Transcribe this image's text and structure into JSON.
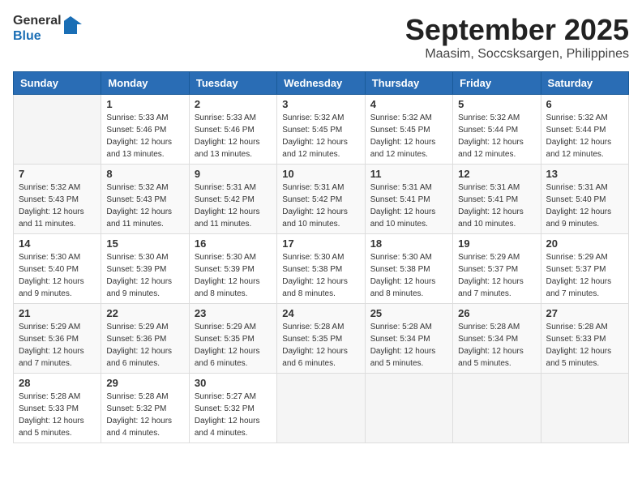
{
  "header": {
    "logo_line1": "General",
    "logo_line2": "Blue",
    "month_title": "September 2025",
    "location": "Maasim, Soccsksargen, Philippines"
  },
  "days_of_week": [
    "Sunday",
    "Monday",
    "Tuesday",
    "Wednesday",
    "Thursday",
    "Friday",
    "Saturday"
  ],
  "weeks": [
    [
      {
        "day": "",
        "sunrise": "",
        "sunset": "",
        "daylight": ""
      },
      {
        "day": "1",
        "sunrise": "Sunrise: 5:33 AM",
        "sunset": "Sunset: 5:46 PM",
        "daylight": "Daylight: 12 hours and 13 minutes."
      },
      {
        "day": "2",
        "sunrise": "Sunrise: 5:33 AM",
        "sunset": "Sunset: 5:46 PM",
        "daylight": "Daylight: 12 hours and 13 minutes."
      },
      {
        "day": "3",
        "sunrise": "Sunrise: 5:32 AM",
        "sunset": "Sunset: 5:45 PM",
        "daylight": "Daylight: 12 hours and 12 minutes."
      },
      {
        "day": "4",
        "sunrise": "Sunrise: 5:32 AM",
        "sunset": "Sunset: 5:45 PM",
        "daylight": "Daylight: 12 hours and 12 minutes."
      },
      {
        "day": "5",
        "sunrise": "Sunrise: 5:32 AM",
        "sunset": "Sunset: 5:44 PM",
        "daylight": "Daylight: 12 hours and 12 minutes."
      },
      {
        "day": "6",
        "sunrise": "Sunrise: 5:32 AM",
        "sunset": "Sunset: 5:44 PM",
        "daylight": "Daylight: 12 hours and 12 minutes."
      }
    ],
    [
      {
        "day": "7",
        "sunrise": "Sunrise: 5:32 AM",
        "sunset": "Sunset: 5:43 PM",
        "daylight": "Daylight: 12 hours and 11 minutes."
      },
      {
        "day": "8",
        "sunrise": "Sunrise: 5:32 AM",
        "sunset": "Sunset: 5:43 PM",
        "daylight": "Daylight: 12 hours and 11 minutes."
      },
      {
        "day": "9",
        "sunrise": "Sunrise: 5:31 AM",
        "sunset": "Sunset: 5:42 PM",
        "daylight": "Daylight: 12 hours and 11 minutes."
      },
      {
        "day": "10",
        "sunrise": "Sunrise: 5:31 AM",
        "sunset": "Sunset: 5:42 PM",
        "daylight": "Daylight: 12 hours and 10 minutes."
      },
      {
        "day": "11",
        "sunrise": "Sunrise: 5:31 AM",
        "sunset": "Sunset: 5:41 PM",
        "daylight": "Daylight: 12 hours and 10 minutes."
      },
      {
        "day": "12",
        "sunrise": "Sunrise: 5:31 AM",
        "sunset": "Sunset: 5:41 PM",
        "daylight": "Daylight: 12 hours and 10 minutes."
      },
      {
        "day": "13",
        "sunrise": "Sunrise: 5:31 AM",
        "sunset": "Sunset: 5:40 PM",
        "daylight": "Daylight: 12 hours and 9 minutes."
      }
    ],
    [
      {
        "day": "14",
        "sunrise": "Sunrise: 5:30 AM",
        "sunset": "Sunset: 5:40 PM",
        "daylight": "Daylight: 12 hours and 9 minutes."
      },
      {
        "day": "15",
        "sunrise": "Sunrise: 5:30 AM",
        "sunset": "Sunset: 5:39 PM",
        "daylight": "Daylight: 12 hours and 9 minutes."
      },
      {
        "day": "16",
        "sunrise": "Sunrise: 5:30 AM",
        "sunset": "Sunset: 5:39 PM",
        "daylight": "Daylight: 12 hours and 8 minutes."
      },
      {
        "day": "17",
        "sunrise": "Sunrise: 5:30 AM",
        "sunset": "Sunset: 5:38 PM",
        "daylight": "Daylight: 12 hours and 8 minutes."
      },
      {
        "day": "18",
        "sunrise": "Sunrise: 5:30 AM",
        "sunset": "Sunset: 5:38 PM",
        "daylight": "Daylight: 12 hours and 8 minutes."
      },
      {
        "day": "19",
        "sunrise": "Sunrise: 5:29 AM",
        "sunset": "Sunset: 5:37 PM",
        "daylight": "Daylight: 12 hours and 7 minutes."
      },
      {
        "day": "20",
        "sunrise": "Sunrise: 5:29 AM",
        "sunset": "Sunset: 5:37 PM",
        "daylight": "Daylight: 12 hours and 7 minutes."
      }
    ],
    [
      {
        "day": "21",
        "sunrise": "Sunrise: 5:29 AM",
        "sunset": "Sunset: 5:36 PM",
        "daylight": "Daylight: 12 hours and 7 minutes."
      },
      {
        "day": "22",
        "sunrise": "Sunrise: 5:29 AM",
        "sunset": "Sunset: 5:36 PM",
        "daylight": "Daylight: 12 hours and 6 minutes."
      },
      {
        "day": "23",
        "sunrise": "Sunrise: 5:29 AM",
        "sunset": "Sunset: 5:35 PM",
        "daylight": "Daylight: 12 hours and 6 minutes."
      },
      {
        "day": "24",
        "sunrise": "Sunrise: 5:28 AM",
        "sunset": "Sunset: 5:35 PM",
        "daylight": "Daylight: 12 hours and 6 minutes."
      },
      {
        "day": "25",
        "sunrise": "Sunrise: 5:28 AM",
        "sunset": "Sunset: 5:34 PM",
        "daylight": "Daylight: 12 hours and 5 minutes."
      },
      {
        "day": "26",
        "sunrise": "Sunrise: 5:28 AM",
        "sunset": "Sunset: 5:34 PM",
        "daylight": "Daylight: 12 hours and 5 minutes."
      },
      {
        "day": "27",
        "sunrise": "Sunrise: 5:28 AM",
        "sunset": "Sunset: 5:33 PM",
        "daylight": "Daylight: 12 hours and 5 minutes."
      }
    ],
    [
      {
        "day": "28",
        "sunrise": "Sunrise: 5:28 AM",
        "sunset": "Sunset: 5:33 PM",
        "daylight": "Daylight: 12 hours and 5 minutes."
      },
      {
        "day": "29",
        "sunrise": "Sunrise: 5:28 AM",
        "sunset": "Sunset: 5:32 PM",
        "daylight": "Daylight: 12 hours and 4 minutes."
      },
      {
        "day": "30",
        "sunrise": "Sunrise: 5:27 AM",
        "sunset": "Sunset: 5:32 PM",
        "daylight": "Daylight: 12 hours and 4 minutes."
      },
      {
        "day": "",
        "sunrise": "",
        "sunset": "",
        "daylight": ""
      },
      {
        "day": "",
        "sunrise": "",
        "sunset": "",
        "daylight": ""
      },
      {
        "day": "",
        "sunrise": "",
        "sunset": "",
        "daylight": ""
      },
      {
        "day": "",
        "sunrise": "",
        "sunset": "",
        "daylight": ""
      }
    ]
  ]
}
